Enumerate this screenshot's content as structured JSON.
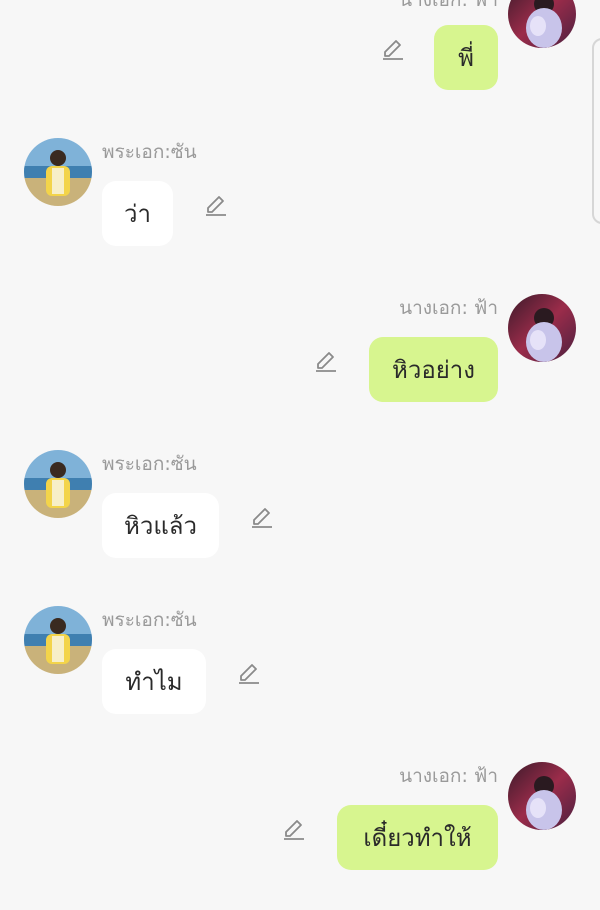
{
  "messages": [
    {
      "side": "right",
      "sender": "นางเอก: ฟ้า",
      "text": "พี่",
      "avatar": "female-avatar"
    },
    {
      "side": "left",
      "sender": "พระเอก:ซัน",
      "text": "ว่า",
      "avatar": "male-avatar"
    },
    {
      "side": "right",
      "sender": "นางเอก: ฟ้า",
      "text": "หิวอย่าง",
      "avatar": "female-avatar"
    },
    {
      "side": "left",
      "sender": "พระเอก:ซัน",
      "text": "หิวแล้ว",
      "avatar": "male-avatar"
    },
    {
      "side": "left",
      "sender": "พระเอก:ซัน",
      "text": "ทำไม",
      "avatar": "male-avatar"
    },
    {
      "side": "right",
      "sender": "นางเอก: ฟ้า",
      "text": "เดี๋ยวทำให้",
      "avatar": "female-avatar"
    }
  ],
  "icons": {
    "edit": "pencil-icon"
  },
  "colors": {
    "background": "#f7f7f7",
    "left_bubble": "#ffffff",
    "right_bubble": "#d7f58f",
    "sender_name": "#9a9a9a"
  }
}
